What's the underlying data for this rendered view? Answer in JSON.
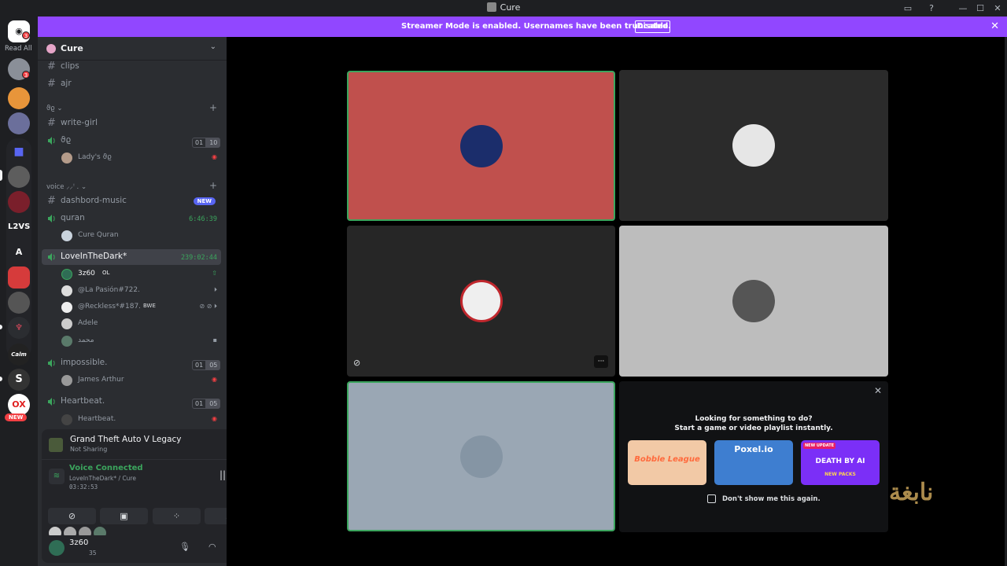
{
  "window": {
    "title": "Cure",
    "buttons": [
      "—",
      "☐",
      "✕"
    ]
  },
  "banner": {
    "message": "Streamer Mode is enabled. Usernames have been truncated.",
    "button": "Disable",
    "close": "✕"
  },
  "rail": {
    "read_all": "Read All",
    "home_badge": "3",
    "dm_badge": "3",
    "servers": [
      {
        "label": ""
      },
      {
        "label": ""
      },
      {
        "label": ""
      },
      {
        "label": ""
      },
      {
        "label": "L2VS"
      },
      {
        "label": "A"
      },
      {
        "label": ""
      },
      {
        "label": ""
      },
      {
        "label": ""
      },
      {
        "label": "Calm"
      },
      {
        "label": "S"
      },
      {
        "label": "OX"
      }
    ],
    "new_badge": "NEW"
  },
  "sidebar": {
    "server_name": "Cure",
    "channels": {
      "clips": "clips",
      "ajr": "ajr",
      "category1": "ϑϱ ⌄",
      "write_girl": "write-girl",
      "voice1": "ϑϱ",
      "voice1_counts": [
        "01",
        "10"
      ],
      "voice1_member": "Lady's ϑϱ",
      "category2": "voice ⸝⸝ꜝ . ⌄",
      "dashbord": "dashbord-music",
      "dashbord_badge": "NEW",
      "quran": "quran",
      "quran_timer": "6:46:39",
      "quran_member": "Cure Quran",
      "lovein": "LoveInTheDark*",
      "lovein_timer": "239:02:44",
      "lovein_members": [
        {
          "name": "3z60",
          "tag": "OL"
        },
        {
          "name": "@La Pasión#722.",
          "tag": ""
        },
        {
          "name": "@Reckless*#187.",
          "tag": "BWE"
        },
        {
          "name": "Adele",
          "tag": ""
        },
        {
          "name": "محمد",
          "tag": ""
        }
      ],
      "impossible": "impossible.",
      "impossible_counts": [
        "01",
        "05"
      ],
      "impossible_member": "James Arthur",
      "heartbeat": "Heartbeat.",
      "heartbeat_counts": [
        "01",
        "05"
      ],
      "heartbeat_member": "Heartbeat."
    }
  },
  "panel": {
    "game_title": "Grand Theft Auto V Legacy",
    "game_status": "Not Sharing",
    "voice_status": "Voice Connected",
    "voice_channel": "LoveInTheDark* / Cure",
    "voice_time": "03:32:53",
    "user_name": "3z60",
    "user_sub": "35"
  },
  "stage": {
    "activity_title": "Looking for something to do?",
    "activity_sub": "Start a game or video playlist instantly.",
    "cards": [
      {
        "label": "Bobble League"
      },
      {
        "label": "Poxel.io"
      },
      {
        "label": "DEATH BY AI",
        "sub": "NEW PACKS",
        "tag": "NEW UPDATE"
      }
    ],
    "dont_show": "Don't show me this again.",
    "more": "···",
    "close": "✕",
    "watermark": "نابغة"
  },
  "colors": {
    "accent": "#9147ff",
    "green": "#3ba55d",
    "tile_red": "#c0504d",
    "tile_dark": "#2b2b2b",
    "tile_gray": "#bdbdbd",
    "tile_blue": "#9aa7b4"
  }
}
